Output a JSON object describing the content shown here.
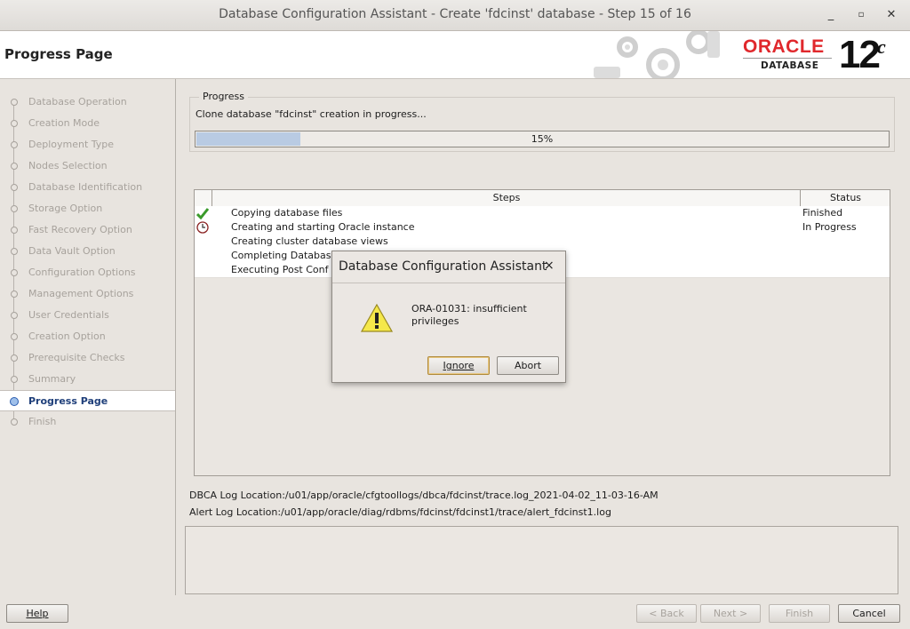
{
  "window": {
    "title": "Database Configuration Assistant - Create 'fdcinst' database - Step 15 of 16",
    "minimize": "_",
    "maximize": "▫",
    "close": "✕"
  },
  "header": {
    "page_title": "Progress Page",
    "logo_brand": "ORACLE",
    "logo_sub": "DATABASE",
    "logo_version": "12",
    "logo_suffix": "c"
  },
  "sidebar": {
    "items": [
      {
        "label": "Database Operation"
      },
      {
        "label": "Creation Mode"
      },
      {
        "label": "Deployment Type"
      },
      {
        "label": "Nodes Selection"
      },
      {
        "label": "Database Identification"
      },
      {
        "label": "Storage Option"
      },
      {
        "label": "Fast Recovery Option"
      },
      {
        "label": "Data Vault Option"
      },
      {
        "label": "Configuration Options"
      },
      {
        "label": "Management Options"
      },
      {
        "label": "User Credentials"
      },
      {
        "label": "Creation Option"
      },
      {
        "label": "Prerequisite Checks"
      },
      {
        "label": "Summary"
      },
      {
        "label": "Progress Page",
        "active": true
      },
      {
        "label": "Finish"
      }
    ]
  },
  "progress": {
    "group_label": "Progress",
    "message": "Clone database \"fdcinst\" creation in progress...",
    "percent": 15,
    "percent_text": "15%"
  },
  "steps_table": {
    "col_steps": "Steps",
    "col_status": "Status",
    "rows": [
      {
        "step": "Copying database files",
        "status": "Finished",
        "icon": "checkmark-icon"
      },
      {
        "step": "Creating and starting Oracle instance",
        "status": "In Progress",
        "icon": "clock-icon"
      },
      {
        "step": "Creating cluster database views",
        "status": "",
        "icon": ""
      },
      {
        "step": "Completing Databas",
        "status": "",
        "icon": ""
      },
      {
        "step": "Executing Post Conf",
        "status": "",
        "icon": ""
      }
    ]
  },
  "logs": {
    "dbca": "DBCA Log Location:/u01/app/oracle/cfgtoollogs/dbca/fdcinst/trace.log_2021-04-02_11-03-16-AM",
    "alert": "Alert Log Location:/u01/app/oracle/diag/rdbms/fdcinst/fdcinst1/trace/alert_fdcinst1.log"
  },
  "buttons": {
    "help": "Help",
    "back": "< Back",
    "next": "Next >",
    "finish": "Finish",
    "cancel": "Cancel"
  },
  "dialog": {
    "title": "Database Configuration Assistant",
    "close": "×",
    "message": "ORA-01031: insufficient privileges",
    "ignore": "Ignore",
    "abort": "Abort",
    "icon": "warning-icon"
  },
  "colors": {
    "oracle_red": "#e0282c",
    "progress_fill": "#b9cbe3",
    "active_nav": "#1f3f7a"
  }
}
